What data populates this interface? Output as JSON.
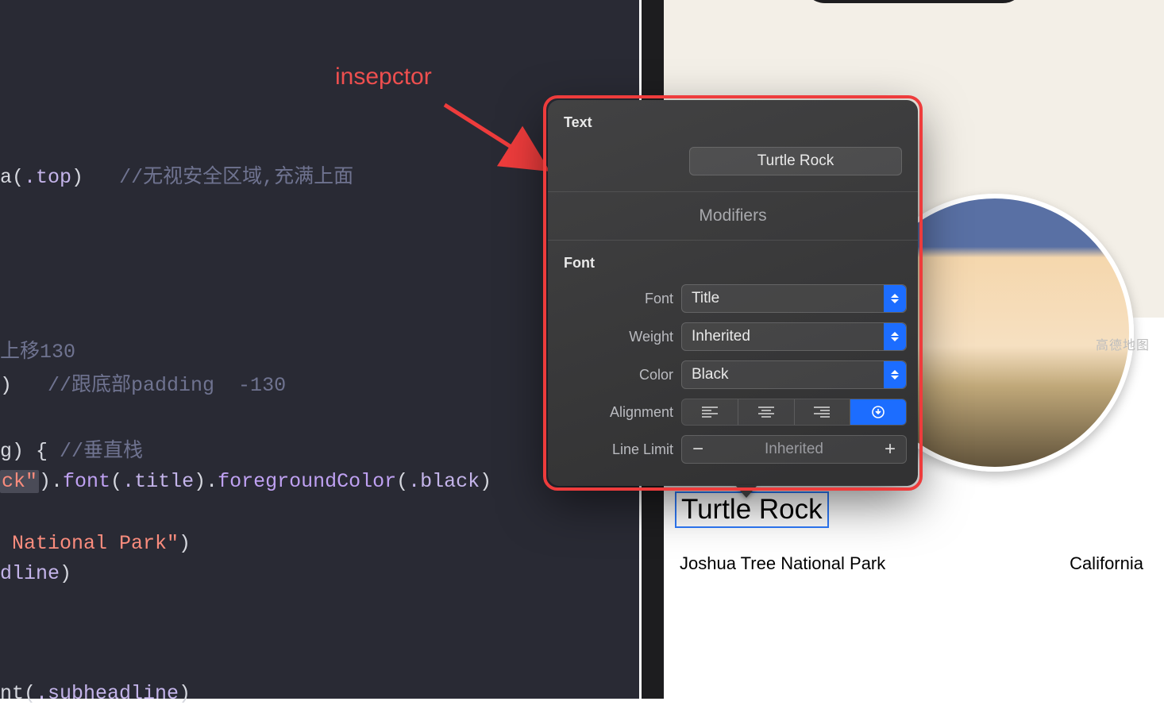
{
  "annotation": {
    "label": "insepctor"
  },
  "code": {
    "l1_a": "a(",
    "l1_b": ".top",
    "l1_c": ")",
    "l1_comment": "//无视安全区域,充满上面",
    "l4_comment": "上移130",
    "l5_a": ")",
    "l5_comment": "//跟底部padding  -130",
    "l7_a": "g) { ",
    "l7_comment": "//垂直栈",
    "l8_a": "ck\"",
    "l8_b": ").",
    "l8_c": "font",
    "l8_d": "(",
    "l8_e": ".title",
    "l8_f": ").",
    "l8_g": "foregroundColor",
    "l8_h": "(",
    "l8_i": ".black",
    "l8_j": ")",
    "l10_a": " National Park\"",
    "l10_b": ")",
    "l11_a": "dline",
    "l11_b": ")",
    "l13_a": "nt(",
    "l13_b": ".subheadline",
    "l13_c": ")"
  },
  "inspector": {
    "section_text": "Text",
    "text_value": "Turtle Rock",
    "modifiers_label": "Modifiers",
    "section_font": "Font",
    "font_label": "Font",
    "font_value": "Title",
    "weight_label": "Weight",
    "weight_value": "Inherited",
    "color_label": "Color",
    "color_value": "Black",
    "alignment_label": "Alignment",
    "linelimit_label": "Line Limit",
    "linelimit_value": "Inherited"
  },
  "preview": {
    "title": "Turtle Rock",
    "subtitle": "Joshua Tree National Park",
    "subtitle_right": "California",
    "map_attrib": "高德地图"
  }
}
